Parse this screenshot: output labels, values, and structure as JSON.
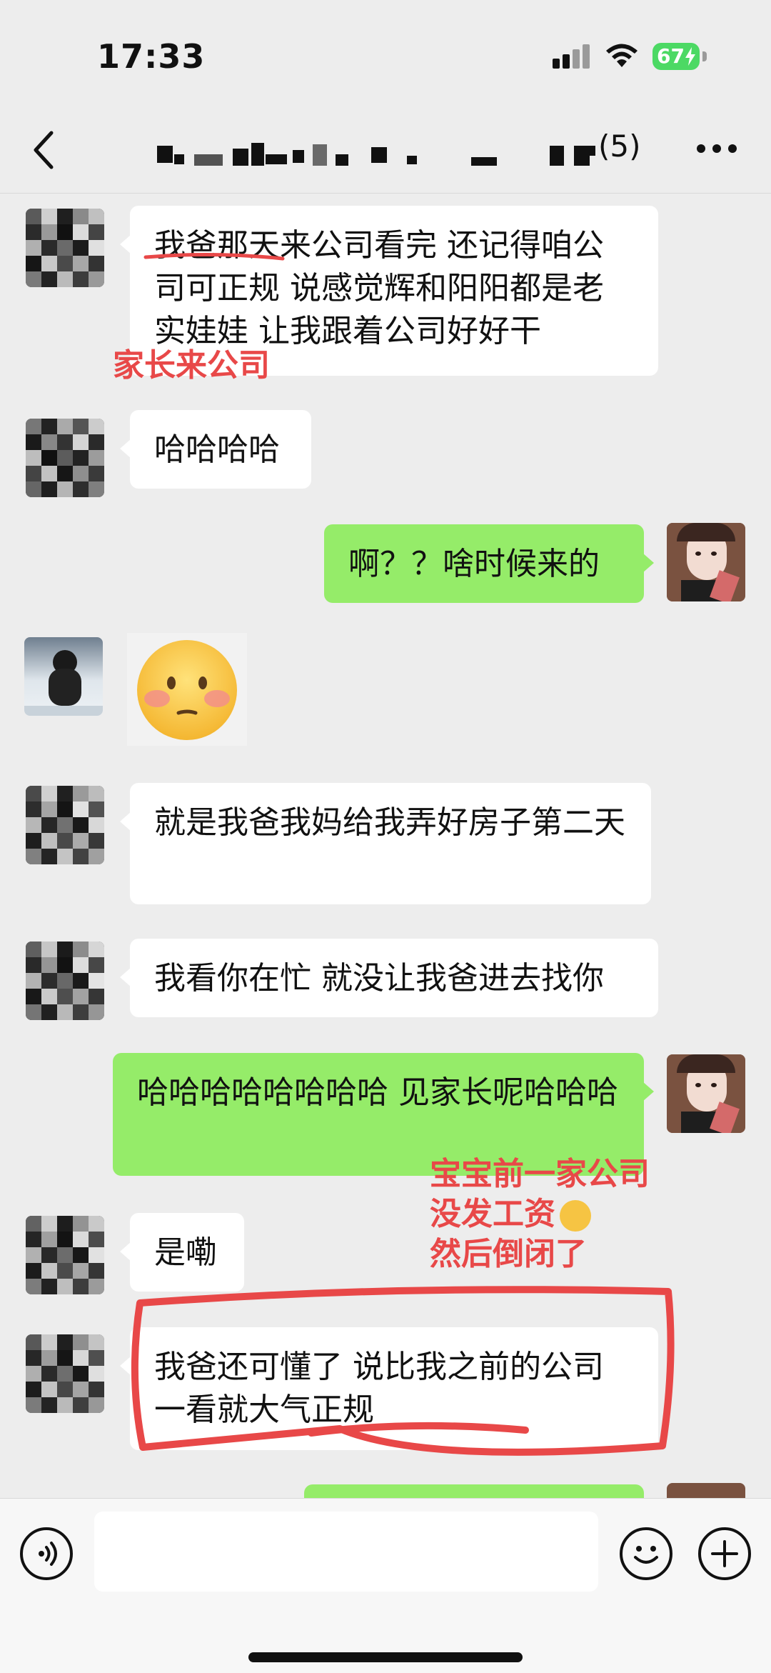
{
  "status_bar": {
    "time": "17:33",
    "battery": "67"
  },
  "nav": {
    "count": "(5)"
  },
  "messages": [
    {
      "side": "left",
      "text": "我爸那天来公司看完 还记得咱公司可正规 说感觉辉和阳阳都是老实娃娃 让我跟着公司好好干"
    },
    {
      "side": "left",
      "text": "哈哈哈哈"
    },
    {
      "side": "right",
      "text": "啊？？啥时候来的"
    },
    {
      "side": "left",
      "type": "emoji",
      "emoji": "blush-face"
    },
    {
      "side": "left",
      "text": "就是我爸我妈给我弄好房子第二天"
    },
    {
      "side": "left",
      "text": "我看你在忙 就没让我爸进去找你"
    },
    {
      "side": "right",
      "text": "哈哈哈哈哈哈哈哈 见家长呢哈哈哈"
    },
    {
      "side": "left",
      "text": "是嘞"
    },
    {
      "side": "left",
      "text": "我爸还可懂了 说比我之前的公司一看就大气正规"
    }
  ],
  "annotations": {
    "parents": "家长来公司",
    "note_line1": "宝宝前一家公司",
    "note_line2": "没发工资",
    "note_line3": "然后倒闭了"
  },
  "colors": {
    "background": "#ededed",
    "bubble_green": "#95ec69",
    "annotation_red": "#e84848",
    "battery_green": "#4cd964"
  },
  "icons": [
    "back-icon",
    "more-icon",
    "voice-icon",
    "emoji-icon",
    "plus-icon",
    "signal-icon",
    "wifi-icon"
  ]
}
